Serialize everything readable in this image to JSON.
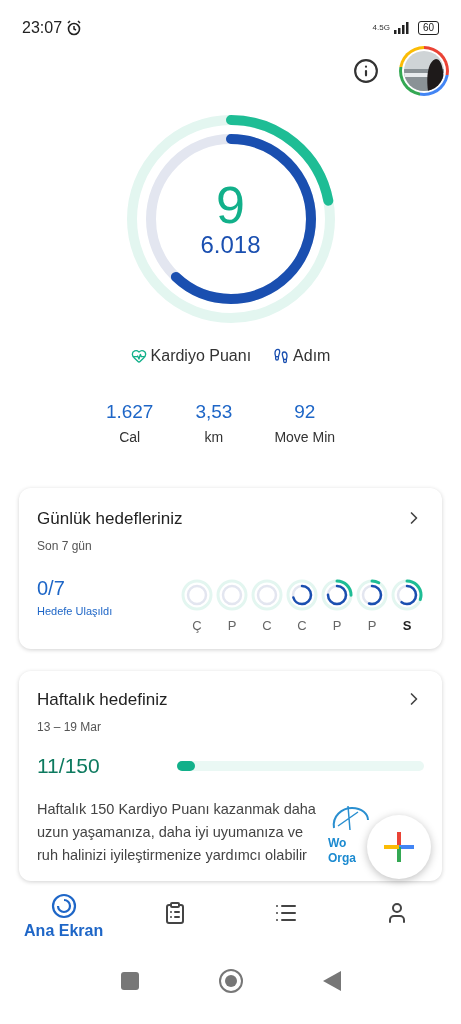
{
  "status_bar": {
    "time": "23:07",
    "network": "4.5G",
    "battery": "60"
  },
  "summary": {
    "cardio_points": "9",
    "steps": "6.018"
  },
  "legend": [
    {
      "kind": "cardio",
      "label": "Kardiyo Puanı"
    },
    {
      "kind": "steps",
      "label": "Adım"
    }
  ],
  "stats": [
    {
      "value": "1.627",
      "label": "Cal"
    },
    {
      "value": "3,53",
      "label": "km"
    },
    {
      "value": "92",
      "label": "Move Min"
    }
  ],
  "daily_goals": {
    "title": "Günlük hedefleriniz",
    "subtitle": "Son 7 gün",
    "count": "0/7",
    "caption": "Hedefe Ulaşıldı",
    "days": [
      {
        "label": "Ç",
        "selected": false
      },
      {
        "label": "P",
        "selected": false
      },
      {
        "label": "C",
        "selected": false
      },
      {
        "label": "C",
        "selected": false
      },
      {
        "label": "P",
        "selected": false
      },
      {
        "label": "P",
        "selected": false
      },
      {
        "label": "S",
        "selected": true
      }
    ]
  },
  "weekly_goal": {
    "title": "Haftalık hedefiniz",
    "dates": "13 – 19 Mar",
    "count": "11/150",
    "level": 0.07,
    "text": "Haftalık 150 Kardiyo Puanı kazanmak daha uzun yaşamanıza, daha iyi uyumanıza ve ruh halinizi iyileştirmenize yardımcı olabilir",
    "logo_text": [
      "Wo",
      "Orga"
    ]
  },
  "nav": [
    {
      "kind": "home",
      "label": "Ana Ekran",
      "selected": true
    },
    {
      "kind": "journal",
      "selected": false
    },
    {
      "kind": "browse",
      "selected": false
    },
    {
      "kind": "profile",
      "selected": false
    }
  ]
}
